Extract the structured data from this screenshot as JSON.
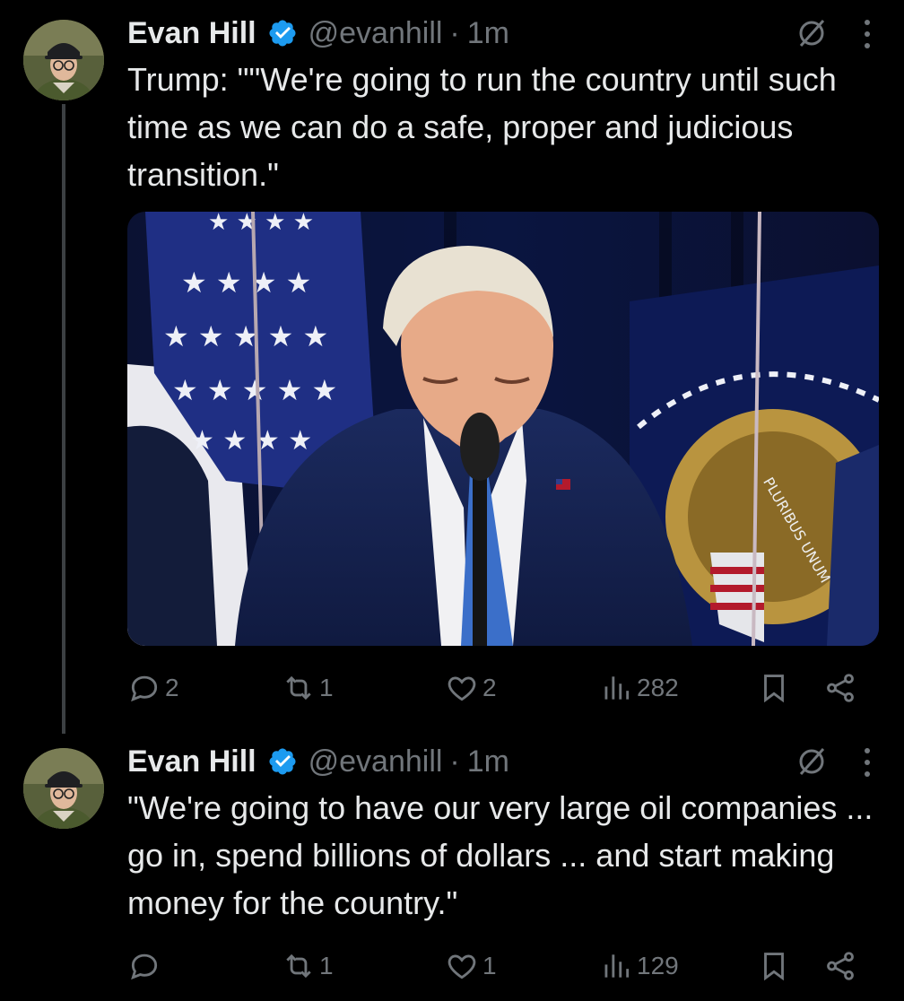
{
  "tweets": [
    {
      "author": {
        "name": "Evan Hill",
        "handle": "@evanhill",
        "time": "1m"
      },
      "text": "Trump: \"\"We're going to run the country until such time as we can do a safe, proper and judicious transition.\"",
      "media": {
        "type": "image",
        "alt": "Man in a dark suit and blue tie speaking at a microphone in front of flags"
      },
      "stats": {
        "replies": "2",
        "reposts": "1",
        "likes": "2",
        "views": "282"
      }
    },
    {
      "author": {
        "name": "Evan Hill",
        "handle": "@evanhill",
        "time": "1m"
      },
      "text": "\"We're going to have our very large oil companies ... go in, spend billions of dollars ... and start making money for the country.\"",
      "stats": {
        "replies": "",
        "reposts": "1",
        "likes": "1",
        "views": "129"
      }
    }
  ],
  "seal_text": "PLURIBUS UNUM",
  "colors": {
    "background": "#000000",
    "text": "#e7e9ea",
    "muted": "#71767b",
    "verified": "#1d9bf0",
    "thread_line": "#3c4043"
  },
  "icons": [
    "verified-badge-icon",
    "grok-icon",
    "more-icon",
    "reply-icon",
    "repost-icon",
    "like-icon",
    "views-icon",
    "bookmark-icon",
    "share-icon"
  ]
}
